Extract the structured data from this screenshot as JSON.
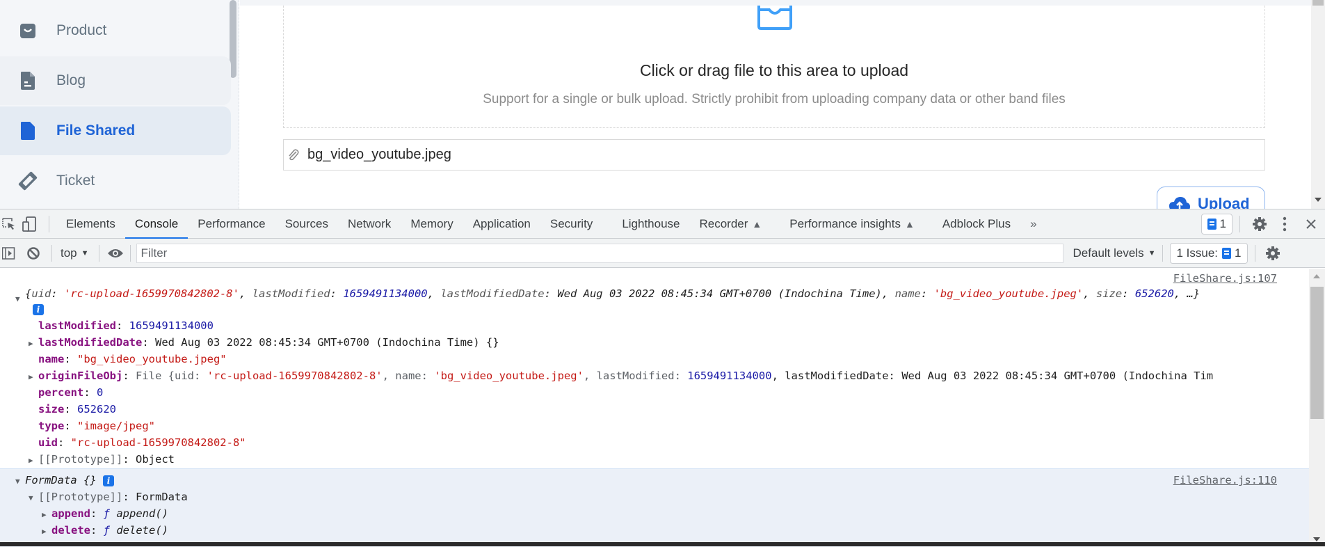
{
  "sidebar": {
    "items": [
      {
        "label": "Product",
        "icon": "shopping-bag-icon",
        "state": "normal"
      },
      {
        "label": "Blog",
        "icon": "document-icon",
        "state": "hover"
      },
      {
        "label": "File Shared",
        "icon": "document-icon",
        "state": "active"
      },
      {
        "label": "Ticket",
        "icon": "ticket-icon",
        "state": "normal"
      }
    ]
  },
  "upload": {
    "title": "Click or drag file to this area to upload",
    "hint": "Support for a single or bulk upload. Strictly prohibit from uploading company data or other band files",
    "file_name": "bg_video_youtube.jpeg",
    "button_label": "Upload",
    "accent_color": "#1f64d6"
  },
  "devtools": {
    "tabs": [
      {
        "label": "Elements",
        "active": false
      },
      {
        "label": "Console",
        "active": true
      },
      {
        "label": "Performance",
        "active": false
      },
      {
        "label": "Sources",
        "active": false
      },
      {
        "label": "Network",
        "active": false
      },
      {
        "label": "Memory",
        "active": false
      },
      {
        "label": "Application",
        "active": false
      },
      {
        "label": "Security",
        "active": false
      },
      {
        "label": "Lighthouse",
        "active": false
      },
      {
        "label": "Recorder",
        "active": false,
        "experimental": true
      },
      {
        "label": "Performance insights",
        "active": false,
        "experimental": true
      },
      {
        "label": "Adblock Plus",
        "active": false
      }
    ],
    "more_tabs": "»",
    "issues_count": "1",
    "context": "top",
    "filter_placeholder": "Filter",
    "levels": "Default levels",
    "issue_label": "1 Issue:",
    "issue_badge_count": "1"
  },
  "console": {
    "entry1": {
      "source": "FileShare.js:107",
      "summary": {
        "open": "{",
        "uid_key": "uid",
        "uid_val": "'rc-upload-1659970842802-8'",
        "lm_key": "lastModified",
        "lm_val": "1659491134000",
        "lmd_key": "lastModifiedDate",
        "lmd_val": "Wed Aug 03 2022 08:45:34 GMT+0700 (Indochina Time)",
        "name_key": "name",
        "name_val": "'bg_video_youtube.jpeg'",
        "size_key": "size",
        "size_val": "652620",
        "close": ", …}"
      },
      "props": {
        "lastModified": {
          "key": "lastModified",
          "value": "1659491134000"
        },
        "lastModifiedDate": {
          "key": "lastModifiedDate",
          "value": "Wed Aug 03 2022 08:45:34 GMT+0700 (Indochina Time) {}"
        },
        "name": {
          "key": "name",
          "value": "\"bg_video_youtube.jpeg\""
        },
        "originFileObj": {
          "key": "originFileObj",
          "prefix": "File {uid: ",
          "uid": "'rc-upload-1659970842802-8'",
          "name_label": ", name: ",
          "name": "'bg_video_youtube.jpeg'",
          "lm_label": ", lastModified: ",
          "lm": "1659491134000",
          "rest": ", lastModifiedDate: Wed Aug 03 2022 08:45:34 GMT+0700 (Indochina Tim"
        },
        "percent": {
          "key": "percent",
          "value": "0"
        },
        "size": {
          "key": "size",
          "value": "652620"
        },
        "type": {
          "key": "type",
          "value": "\"image/jpeg\""
        },
        "uid": {
          "key": "uid",
          "value": "\"rc-upload-1659970842802-8\""
        },
        "prototype": {
          "key": "[[Prototype]]",
          "value": "Object"
        }
      }
    },
    "entry2": {
      "source": "FileShare.js:110",
      "title": "FormData {}",
      "prototype": {
        "key": "[[Prototype]]",
        "value": "FormData"
      },
      "methods": [
        {
          "key": "append",
          "value": "append()"
        },
        {
          "key": "delete",
          "value": "delete()"
        }
      ]
    }
  }
}
